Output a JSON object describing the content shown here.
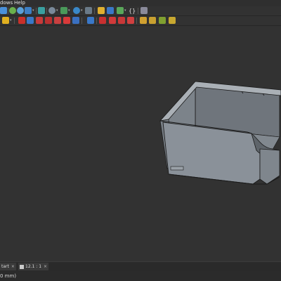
{
  "menu": {
    "windows_label": "dows",
    "help_label": "Help"
  },
  "toolbar2": {
    "braces_label": "{}"
  },
  "tabs": [
    {
      "label": "tart",
      "close": "×"
    },
    {
      "label": "12.1 : 1",
      "close": "×"
    }
  ],
  "status": {
    "text": "0 mm)"
  },
  "colors": {
    "viewport": "#323232",
    "model_wall": "#8a9199",
    "model_edge": "#1a1a1a",
    "toolbar_bg": "#323232"
  },
  "icons": [
    "zoom-icon",
    "box-view-icon",
    "home-view-icon",
    "view-menu-icon",
    "measure-icon",
    "part-icon",
    "sketch-icon",
    "macro-icon",
    "pointer-icon",
    "cube-icon",
    "cylinder-icon",
    "cone-icon",
    "sphere-icon",
    "boolean-icon",
    "cut-icon",
    "fuse-icon",
    "common-icon"
  ]
}
